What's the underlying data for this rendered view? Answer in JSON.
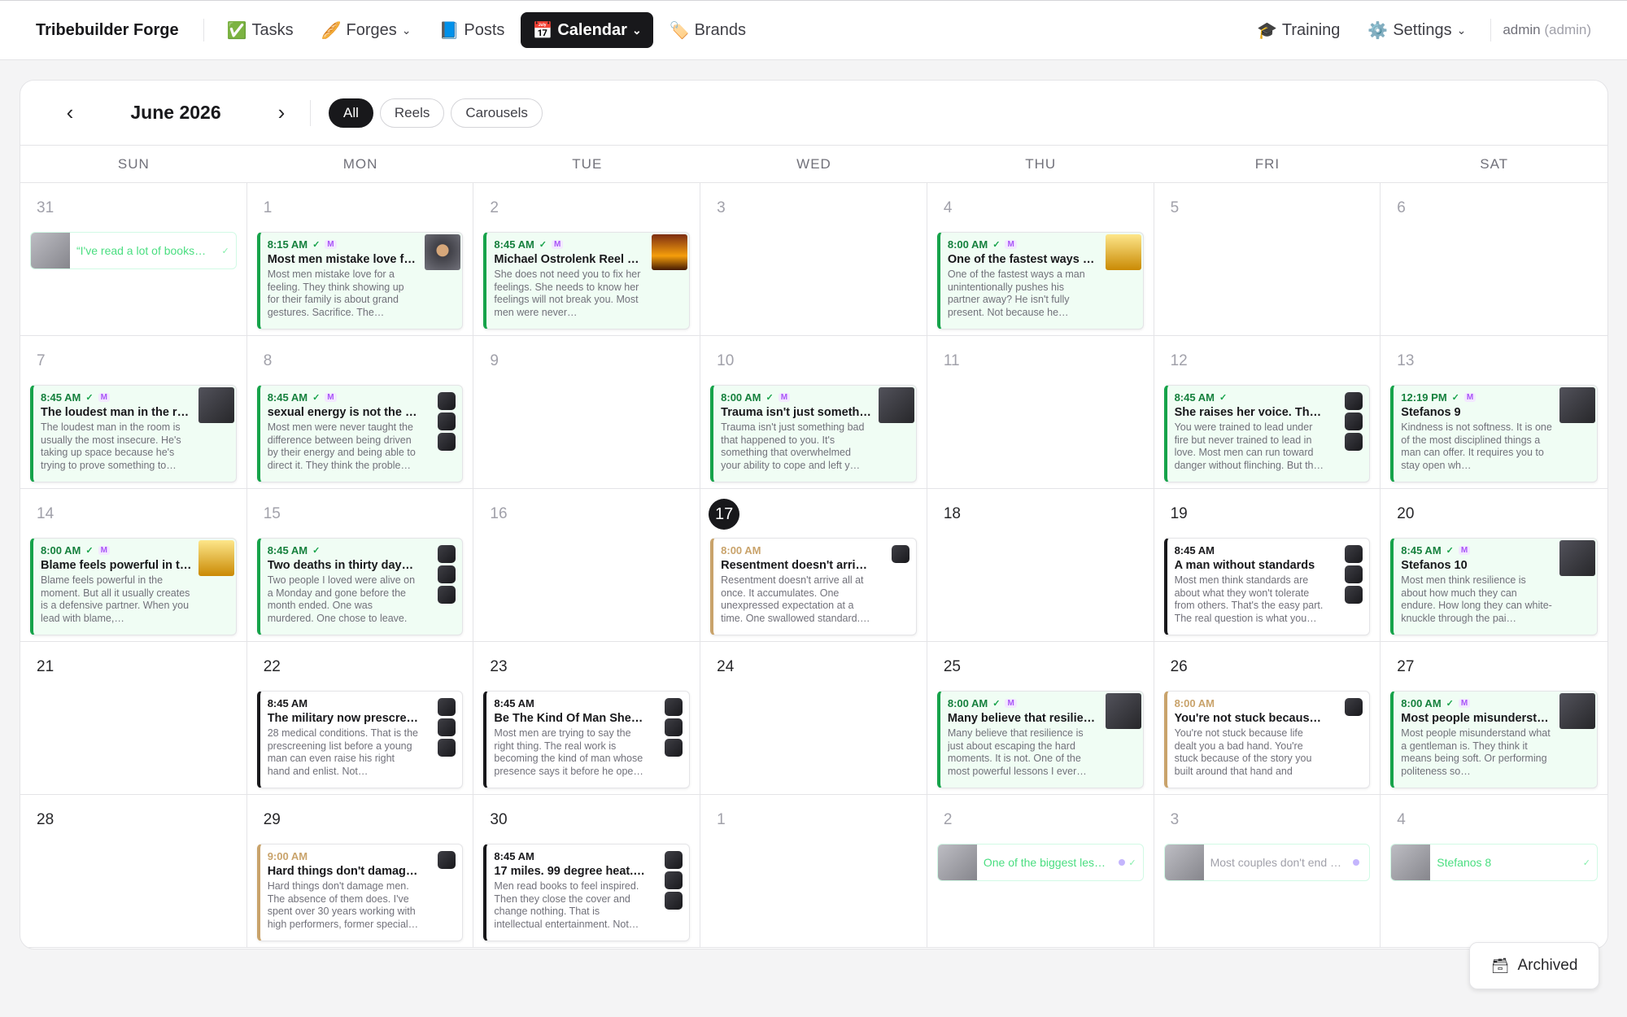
{
  "app": {
    "brand": "Tribebuilder Forge",
    "user": "admin",
    "role": "(admin)"
  },
  "nav": [
    {
      "icon": "✅",
      "label": "Tasks",
      "dropdown": false,
      "active": false
    },
    {
      "icon": "🥖",
      "label": "Forges",
      "dropdown": true,
      "active": false
    },
    {
      "icon": "📘",
      "label": "Posts",
      "dropdown": false,
      "active": false
    },
    {
      "icon": "📅",
      "label": "Calendar",
      "dropdown": true,
      "active": true
    },
    {
      "icon": "🏷️",
      "label": "Brands",
      "dropdown": false,
      "active": false
    }
  ],
  "nav_right": [
    {
      "icon": "🎓",
      "label": "Training",
      "dropdown": false
    },
    {
      "icon": "⚙️",
      "label": "Settings",
      "dropdown": true
    }
  ],
  "calendar": {
    "month": "June 2026",
    "filters": [
      {
        "label": "All",
        "active": true
      },
      {
        "label": "Reels",
        "active": false
      },
      {
        "label": "Carousels",
        "active": false
      }
    ],
    "weekdays": [
      "SUN",
      "MON",
      "TUE",
      "WED",
      "THU",
      "FRI",
      "SAT"
    ],
    "days": [
      {
        "n": "31",
        "muted": true,
        "mini": {
          "label": "“I've read a lot of books…",
          "status": "check"
        }
      },
      {
        "n": "1",
        "muted": true,
        "card": {
          "time": "8:15 AM",
          "check": true,
          "m": true,
          "title": "Most men mistake love fo…",
          "body": "Most men mistake love for a feeling. They think showing up for their family is about grand gestures. Sacrifice. The…",
          "style": "green",
          "thumb": "face"
        }
      },
      {
        "n": "2",
        "muted": true,
        "card": {
          "time": "8:45 AM",
          "check": true,
          "m": true,
          "title": "Michael Ostrolenk Reel —…",
          "body": "She does not need you to fix her feelings. She needs to know her feelings will not break you. Most men were never…",
          "style": "green",
          "thumb": "sun"
        }
      },
      {
        "n": "3",
        "muted": true
      },
      {
        "n": "4",
        "muted": true,
        "card": {
          "time": "8:00 AM",
          "check": true,
          "m": true,
          "title": "One of the fastest ways a…",
          "body": "One of the fastest ways a man unintentionally pushes his partner away? He isn't fully present. Not because he…",
          "style": "green",
          "thumb": "yel"
        }
      },
      {
        "n": "5",
        "muted": true
      },
      {
        "n": "6",
        "muted": true
      },
      {
        "n": "7",
        "muted": true,
        "card": {
          "time": "8:45 AM",
          "check": true,
          "m": true,
          "title": "The loudest man in the ro…",
          "body": "The loudest man in the room is usually the most insecure. He's taking up space because he's trying to prove something to…",
          "style": "green",
          "thumb": "dark"
        }
      },
      {
        "n": "8",
        "muted": true,
        "card": {
          "time": "8:45 AM",
          "check": true,
          "m": true,
          "title": "sexual energy is not the pr…",
          "body": "Most men were never taught the difference between being driven by their energy and being able to direct it. They think the proble…",
          "style": "green",
          "stack": 3
        }
      },
      {
        "n": "9",
        "muted": true
      },
      {
        "n": "10",
        "muted": true,
        "card": {
          "time": "8:00 AM",
          "check": true,
          "m": true,
          "title": "Trauma isn't just somethi…",
          "body": "Trauma isn't just something bad that happened to you. It's something that overwhelmed your ability to cope and left y…",
          "style": "green",
          "thumb": "dark"
        }
      },
      {
        "n": "11",
        "muted": true
      },
      {
        "n": "12",
        "muted": true,
        "card": {
          "time": "8:45 AM",
          "check": true,
          "m": false,
          "title": "She raises her voice. The c…",
          "body": "You were trained to lead under fire but never trained to lead in love. Most men can run toward danger without flinching. But th…",
          "style": "green",
          "stack": 3
        }
      },
      {
        "n": "13",
        "muted": true,
        "card": {
          "time": "12:19 PM",
          "check": true,
          "m": true,
          "title": "Stefanos 9",
          "body": "Kindness is not softness. It is one of the most disciplined things a man can offer. It requires you to stay open wh…",
          "style": "green",
          "thumb": "dark"
        }
      },
      {
        "n": "14",
        "muted": true,
        "card": {
          "time": "8:00 AM",
          "check": true,
          "m": true,
          "title": "Blame feels powerful in t…",
          "body": "Blame feels powerful in the moment. But all it usually creates is a defensive partner. When you lead with blame,…",
          "style": "green",
          "thumb": "yel"
        }
      },
      {
        "n": "15",
        "muted": true,
        "card": {
          "time": "8:45 AM",
          "check": true,
          "m": false,
          "title": "Two deaths in thirty days e…",
          "body": "Two people I loved were alive on a Monday and gone before the month ended. One was murdered. One chose to leave. …",
          "style": "green",
          "stack": 3
        }
      },
      {
        "n": "16",
        "muted": true
      },
      {
        "n": "17",
        "today": true,
        "card": {
          "time": "8:00 AM",
          "check": false,
          "m": false,
          "title": "Resentment doesn't arrive …",
          "body": "Resentment doesn't arrive all at once. It accumulates. One unexpressed expectation at a time. One swallowed standard.…",
          "style": "tan",
          "stack": 1
        }
      },
      {
        "n": "18"
      },
      {
        "n": "19",
        "card": {
          "time": "8:45 AM",
          "check": false,
          "m": false,
          "title": "A man without standards",
          "body": "Most men think standards are about what they won't tolerate from others. That's the easy part. The real question is what you…",
          "style": "bk",
          "stack": 3
        }
      },
      {
        "n": "20",
        "card": {
          "time": "8:45 AM",
          "check": true,
          "m": true,
          "title": "Stefanos 10",
          "body": "Most men think resilience is about how much they can endure. How long they can white-knuckle through the pai…",
          "style": "green",
          "thumb": "dark"
        }
      },
      {
        "n": "21"
      },
      {
        "n": "22",
        "card": {
          "time": "8:45 AM",
          "check": false,
          "m": false,
          "title": "The military now prescree…",
          "body": "28 medical conditions. That is the prescreening list before a young man can even raise his right hand and enlist. Not…",
          "style": "bk",
          "stack": 3
        }
      },
      {
        "n": "23",
        "card": {
          "time": "8:45 AM",
          "check": false,
          "m": false,
          "title": "Be The Kind Of Man She C…",
          "body": "Most men are trying to say the right thing. The real work is becoming the kind of man whose presence says it before he ope…",
          "style": "bk",
          "stack": 3
        }
      },
      {
        "n": "24"
      },
      {
        "n": "25",
        "card": {
          "time": "8:00 AM",
          "check": true,
          "m": true,
          "title": "Many believe that resilien…",
          "body": "Many believe that resilience is just about escaping the hard moments. It is not. One of the most powerful lessons I ever…",
          "style": "green",
          "thumb": "dark"
        }
      },
      {
        "n": "26",
        "card": {
          "time": "8:00 AM",
          "check": false,
          "m": false,
          "title": "You're not stuck because li…",
          "body": "You're not stuck because life dealt you a bad hand. You're stuck because of the story you built around that hand and have…",
          "style": "tan",
          "stack": 1
        }
      },
      {
        "n": "27",
        "card": {
          "time": "8:00 AM",
          "check": true,
          "m": true,
          "title": "Most people misundersta…",
          "body": "Most people misunderstand what a gentleman is. They think it means being soft. Or performing politeness so…",
          "style": "green",
          "thumb": "dark"
        }
      },
      {
        "n": "28"
      },
      {
        "n": "29",
        "card": {
          "time": "9:00 AM",
          "check": false,
          "m": false,
          "title": "Hard things don't damage …",
          "body": "Hard things don't damage men. The absence of them does. I've spent over 30 years working with high performers, former special…",
          "style": "tan",
          "stack": 1
        }
      },
      {
        "n": "30",
        "card": {
          "time": "8:45 AM",
          "check": false,
          "m": false,
          "title": "17 miles. 99 degree heat. E…",
          "body": "Men read books to feel inspired. Then they close the cover and change nothing. That is intellectual entertainment. Not…",
          "style": "bk",
          "stack": 3
        }
      },
      {
        "n": "1",
        "muted": true
      },
      {
        "n": "2",
        "muted": true,
        "mini": {
          "label": "One of the biggest les…",
          "status": "dot-check"
        }
      },
      {
        "n": "3",
        "muted": true,
        "mini": {
          "label": "Most couples don't end …",
          "status": "dot",
          "gray": true
        }
      },
      {
        "n": "4",
        "muted": true,
        "mini": {
          "label": "Stefanos 8",
          "status": "check"
        }
      }
    ]
  },
  "archived_label": "Archived",
  "colors": {
    "accent": "#18181b",
    "posted": "#16a34a",
    "scheduled": "#c9a36b",
    "draft": "#18181b"
  }
}
